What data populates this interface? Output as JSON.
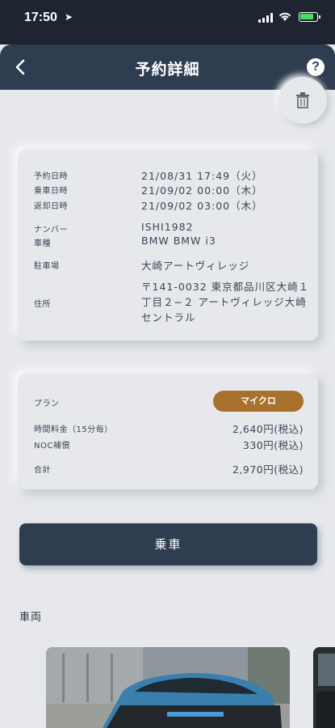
{
  "status_bar": {
    "time": "17:50",
    "location_glyph": "➤"
  },
  "nav": {
    "title": "予約詳細",
    "help_glyph": "?"
  },
  "details": {
    "reserved_at_label": "予約日時",
    "reserved_at_value": "21/08/31 17:49（火）",
    "ride_at_label": "乗車日時",
    "ride_at_value": "21/09/02 00:00（木）",
    "return_at_label": "返却日時",
    "return_at_value": "21/09/02 03:00（木）",
    "number_label": "ナンバー",
    "number_value": "ISHI1982",
    "model_label": "車種",
    "model_value": "BMW BMW i3",
    "parking_label": "駐車場",
    "parking_value": "大崎アートヴィレッジ",
    "address_label": "住所",
    "address_value": "〒141-0032 東京都品川区大崎１丁目２−２ アートヴィレッジ大崎セントラル"
  },
  "pricing": {
    "plan_label": "プラン",
    "plan_value": "マイクロ",
    "time_fee_label": "時間料金（15分毎）",
    "time_fee_value": "2,640円(税込)",
    "noc_label": "NOC補償",
    "noc_value": "330円(税込)",
    "total_label": "合計",
    "total_value": "2,970円(税込)"
  },
  "ride_button_label": "乗車",
  "vehicle_section_title": "車両",
  "colors": {
    "nav": "#2e3d50",
    "accent": "#a8722c",
    "background": "#e6e8ec"
  }
}
